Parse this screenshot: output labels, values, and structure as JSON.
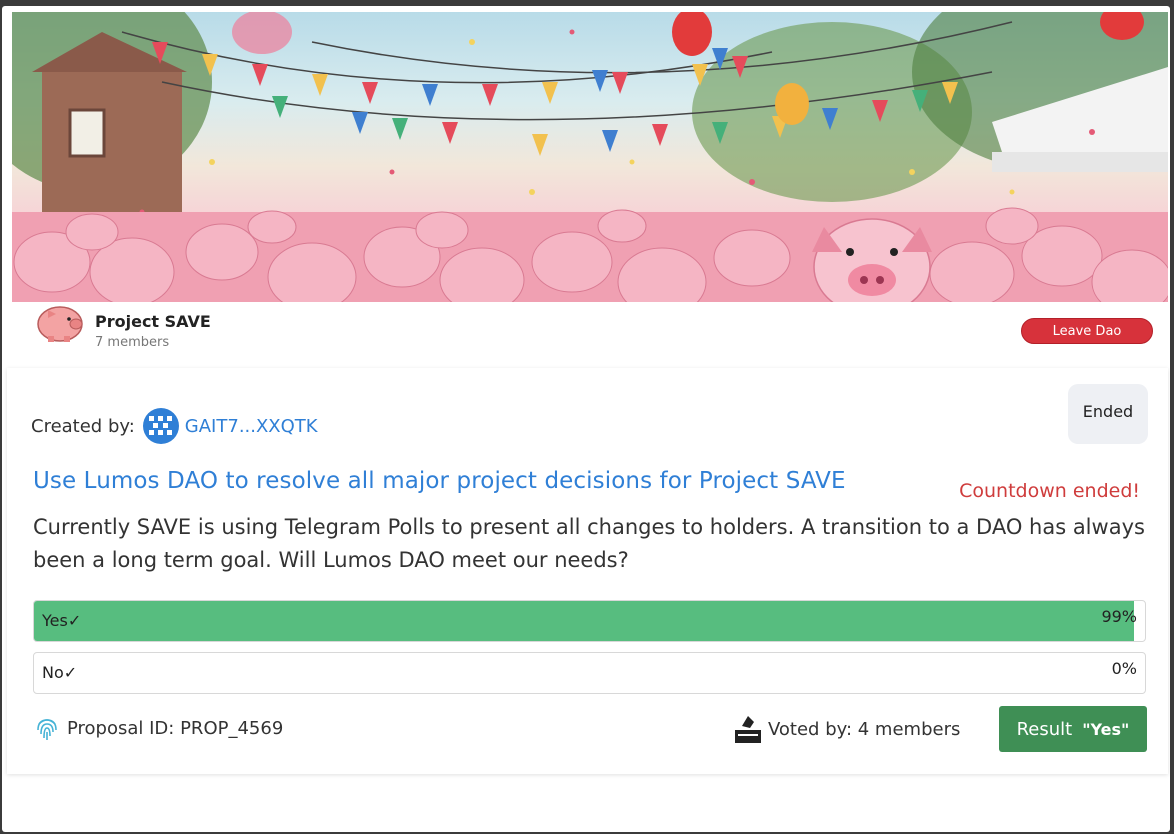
{
  "dao": {
    "name": "Project SAVE",
    "members": "7 members",
    "leave_label": "Leave Dao"
  },
  "proposal": {
    "created_by_label": "Created by:",
    "creator_address": "GAIT7...XXQTK",
    "status": "Ended",
    "title": "Use Lumos DAO to resolve all major project decisions for Project SAVE",
    "countdown": "Countdown ended!",
    "description": "Currently SAVE is using Telegram Polls to present all changes to holders. A transition to a DAO has always been a long term goal. Will Lumos DAO meet our needs?",
    "options": [
      {
        "label": "Yes",
        "check": "✓",
        "percent_text": "99%",
        "percent": 99
      },
      {
        "label": "No",
        "check": "✓",
        "percent_text": "0%",
        "percent": 0
      }
    ],
    "id_text": "Proposal ID: PROP_4569",
    "voted_text": "Voted by: 4 members",
    "result_label": "Result",
    "result_value": "\"Yes\""
  },
  "colors": {
    "accent_blue": "#2f7fd6",
    "leave_red": "#d7323b",
    "bar_green": "#57bd7f",
    "result_green": "#3f8f55",
    "countdown_red": "#cf3c3c"
  },
  "icons": [
    "pig-avatar-icon",
    "qr-identicon-icon",
    "fingerprint-icon",
    "ballot-box-icon",
    "check-icon"
  ]
}
